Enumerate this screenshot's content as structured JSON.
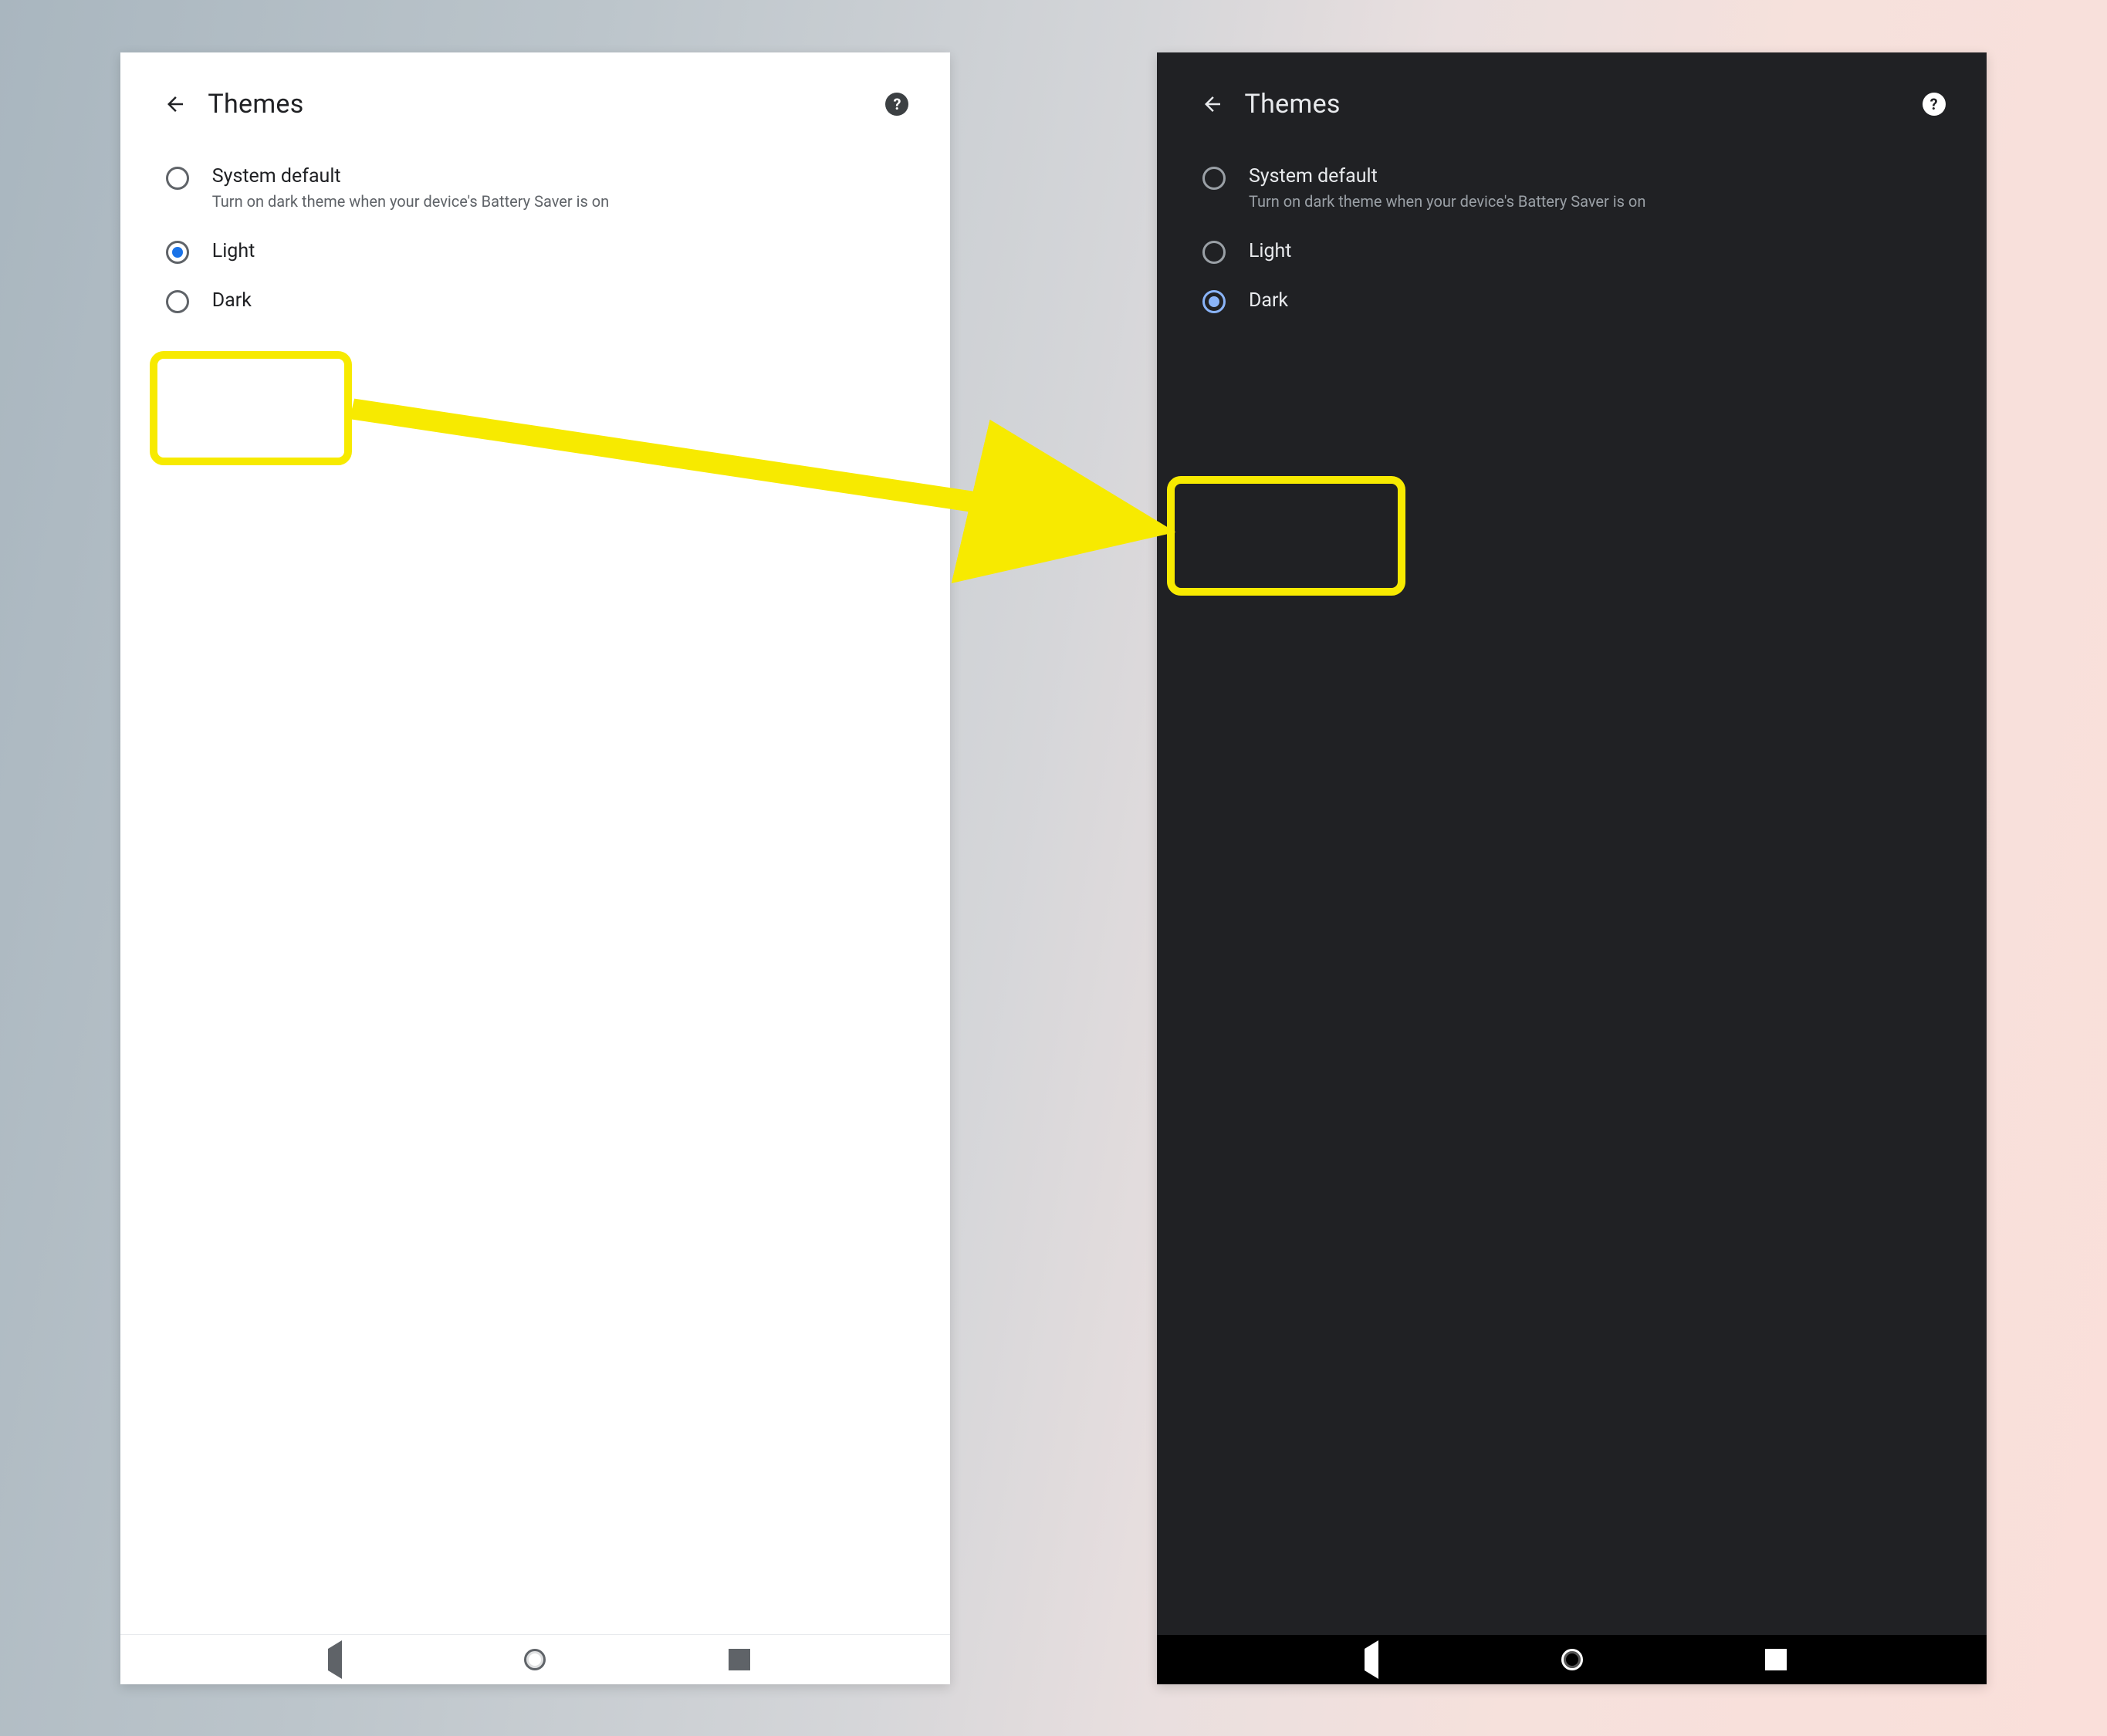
{
  "header": {
    "title": "Themes"
  },
  "options": {
    "system": {
      "label": "System default",
      "sub": "Turn on dark theme when your device's Battery Saver is on"
    },
    "light": {
      "label": "Light"
    },
    "dark": {
      "label": "Dark"
    }
  }
}
